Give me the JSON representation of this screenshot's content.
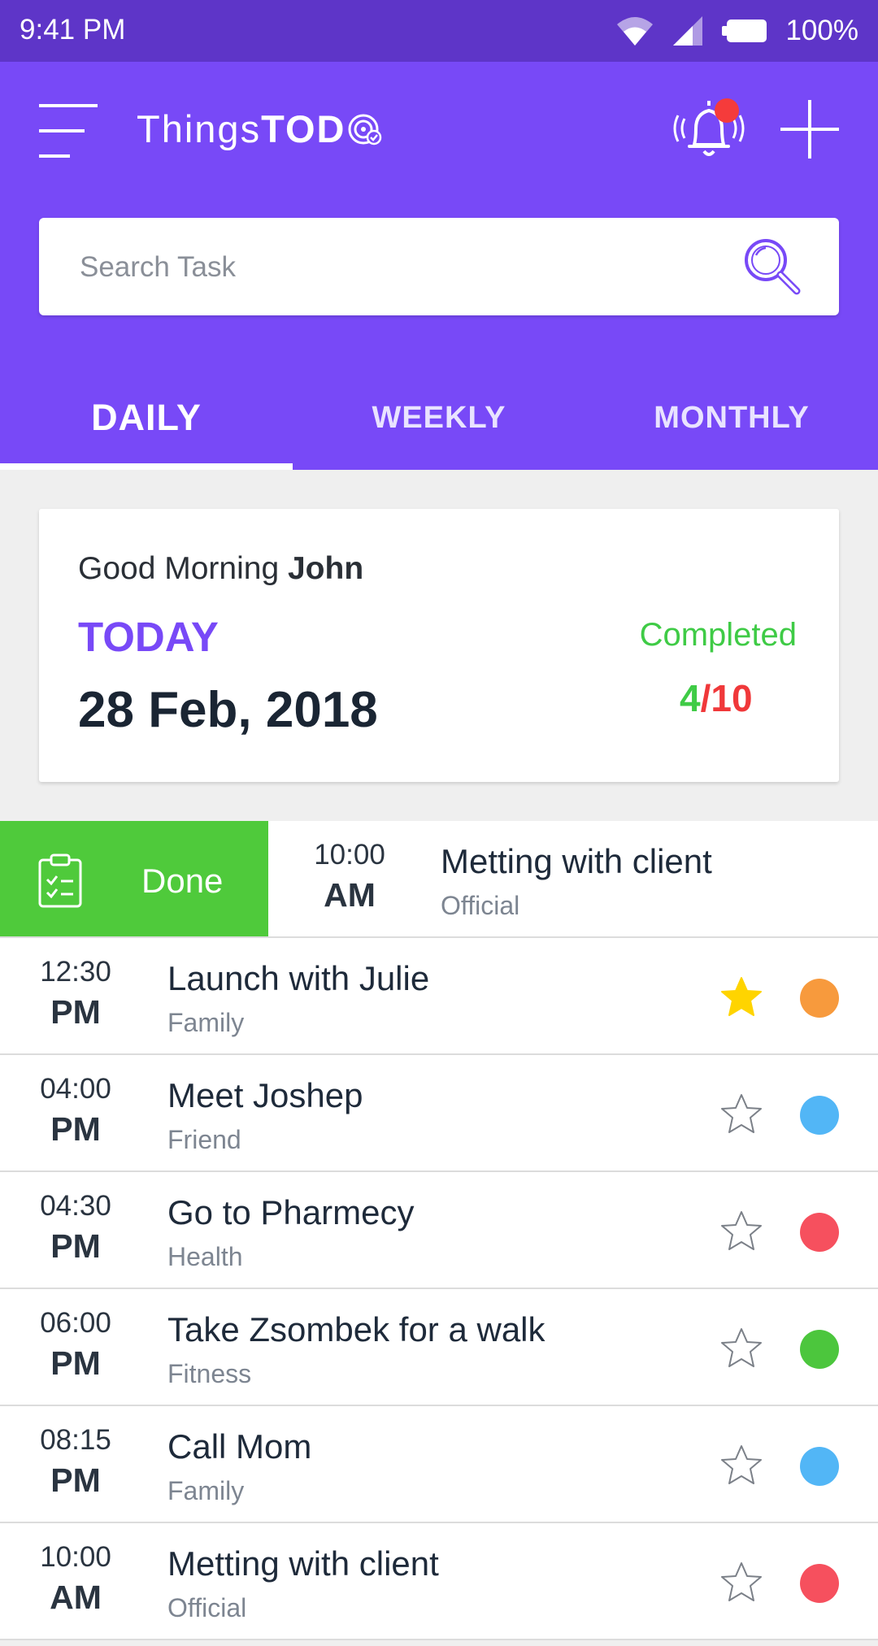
{
  "status_bar": {
    "time": "9:41 PM",
    "battery": "100%"
  },
  "app": {
    "name_light": "Things",
    "name_bold": "TOD"
  },
  "search": {
    "placeholder": "Search Task"
  },
  "tabs": [
    {
      "label": "DAILY",
      "active": true
    },
    {
      "label": "WEEKLY",
      "active": false
    },
    {
      "label": "MONTHLY",
      "active": false
    }
  ],
  "summary": {
    "greeting": "Good Morning",
    "name": "John",
    "day_label": "TODAY",
    "date": "28 Feb, 2018",
    "completed_label": "Completed",
    "completed_count": "4",
    "total_count": "/10"
  },
  "swiped_task": {
    "action_label": "Done",
    "time": "10:00",
    "ampm": "AM",
    "title": "Metting with client",
    "category": "Official"
  },
  "tasks": [
    {
      "time": "12:30",
      "ampm": "PM",
      "title": "Launch with Julie",
      "category": "Family",
      "starred": true,
      "color": "#f79a3d"
    },
    {
      "time": "04:00",
      "ampm": "PM",
      "title": "Meet Joshep",
      "category": "Friend",
      "starred": false,
      "color": "#52b6f6"
    },
    {
      "time": "04:30",
      "ampm": "PM",
      "title": "Go to Pharmecy",
      "category": "Health",
      "starred": false,
      "color": "#f6505e"
    },
    {
      "time": "06:00",
      "ampm": "PM",
      "title": "Take Zsombek for a walk",
      "category": "Fitness",
      "starred": false,
      "color": "#4cc63d"
    },
    {
      "time": "08:15",
      "ampm": "PM",
      "title": "Call Mom",
      "category": "Family",
      "starred": false,
      "color": "#52b6f6"
    },
    {
      "time": "10:00",
      "ampm": "AM",
      "title": "Metting with client",
      "category": "Official",
      "starred": false,
      "color": "#f6505e"
    }
  ],
  "colors": {
    "accent": "#7849f7",
    "status_bar": "#5e35c8",
    "done_green": "#4fca3b",
    "star_active": "#ffd400"
  },
  "icons": {
    "menu": "menu-icon",
    "bell": "bell-icon",
    "add": "plus-icon",
    "search": "search-icon",
    "star": "star-icon",
    "clipboard": "clipboard-check-icon"
  }
}
